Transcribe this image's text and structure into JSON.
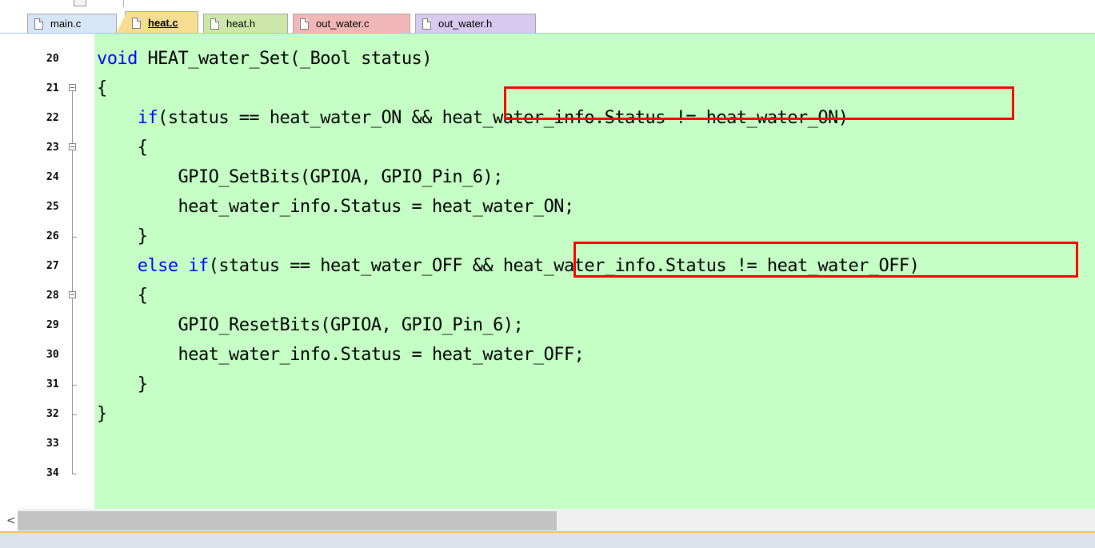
{
  "tabs": [
    {
      "label": "main.c",
      "color": "#d7e6f7",
      "active": false
    },
    {
      "label": "heat.c",
      "color": "#f7dd92",
      "active": true
    },
    {
      "label": "heat.h",
      "color": "#cde7a8",
      "active": false
    },
    {
      "label": "out_water.c",
      "color": "#f1b7b7",
      "active": false
    },
    {
      "label": "out_water.h",
      "color": "#d8c9ef",
      "active": false
    }
  ],
  "editor": {
    "background": "#c6ffc6",
    "keyword_color": "#0000ff",
    "highlight_color": "#ff0000",
    "lines": [
      {
        "num": "20",
        "code": "void HEAT_water_Set(_Bool status)"
      },
      {
        "num": "21",
        "code": "{"
      },
      {
        "num": "22",
        "code": "    if(status == heat_water_ON && heat_water_info.Status != heat_water_ON)"
      },
      {
        "num": "23",
        "code": "    {"
      },
      {
        "num": "24",
        "code": "        GPIO_SetBits(GPIOA, GPIO_Pin_6);"
      },
      {
        "num": "25",
        "code": "        heat_water_info.Status = heat_water_ON;"
      },
      {
        "num": "26",
        "code": "    }"
      },
      {
        "num": "27",
        "code": "    else if(status == heat_water_OFF && heat_water_info.Status != heat_water_OFF)"
      },
      {
        "num": "28",
        "code": "    {"
      },
      {
        "num": "29",
        "code": "        GPIO_ResetBits(GPIOA, GPIO_Pin_6);"
      },
      {
        "num": "30",
        "code": "        heat_water_info.Status = heat_water_OFF;"
      },
      {
        "num": "31",
        "code": "    }"
      },
      {
        "num": "32",
        "code": "}"
      },
      {
        "num": "33",
        "code": ""
      },
      {
        "num": "34",
        "code": ""
      }
    ]
  },
  "scrollbar": {
    "left_arrow": "<"
  }
}
